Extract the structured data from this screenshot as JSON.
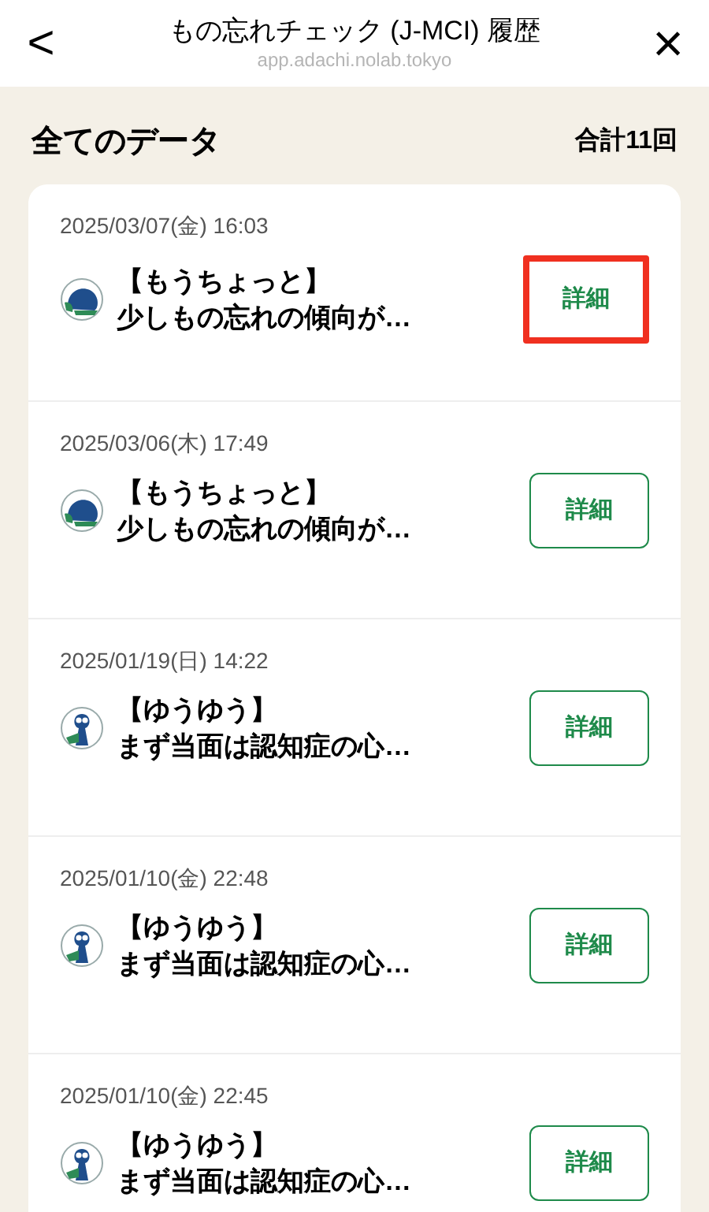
{
  "header": {
    "back": "<",
    "title": "もの忘れチェック (J-MCI) 履歴",
    "url": "app.adachi.nolab.tokyo",
    "close": "×"
  },
  "summary": {
    "title": "全てのデータ",
    "total": "合計11回"
  },
  "records": [
    {
      "date": "2025/03/07(金) 16:03",
      "kind": "blob",
      "result": "【もうちょっと】",
      "message": "少しもの忘れの傾向が…",
      "button": "詳細",
      "highlighted": true
    },
    {
      "date": "2025/03/06(木) 17:49",
      "kind": "blob",
      "result": "【もうちょっと】",
      "message": "少しもの忘れの傾向が…",
      "button": "詳細",
      "highlighted": false
    },
    {
      "date": "2025/01/19(日) 14:22",
      "kind": "figure",
      "result": "【ゆうゆう】",
      "message": "まず当面は認知症の心…",
      "button": "詳細",
      "highlighted": false
    },
    {
      "date": "2025/01/10(金) 22:48",
      "kind": "figure",
      "result": "【ゆうゆう】",
      "message": "まず当面は認知症の心…",
      "button": "詳細",
      "highlighted": false
    },
    {
      "date": "2025/01/10(金) 22:45",
      "kind": "figure",
      "result": "【ゆうゆう】",
      "message": "まず当面は認知症の心…",
      "button": "詳細",
      "highlighted": false
    }
  ]
}
